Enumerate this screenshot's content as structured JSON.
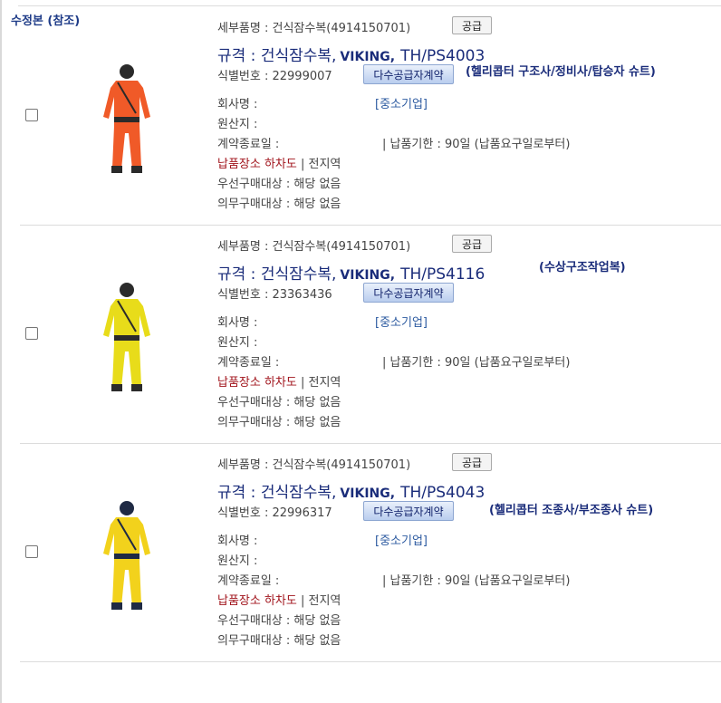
{
  "header": {
    "revision_label": "수정본 (참조)"
  },
  "items": [
    {
      "sub_name": "세부품명 : 건식잠수복(4914150701)",
      "supply_label": "공급",
      "spec_prefix": "규격 : 건식잠수복,",
      "maker": "VIKING,",
      "model": "TH/PS4003",
      "id_no": "식별번호 : 22999007",
      "mas_label": "다수공급자계약",
      "note": "(헬리콥터 구조사/정비사/탑승자 슈트)",
      "company": "회사명 :",
      "sme": "[중소기업]",
      "origin": "원산지 :",
      "contract_end": "계약종료일 :",
      "delivery": "| 납품기한 : 90일 (납품요구일로부터)",
      "place_label": "납품장소 하차도",
      "place_value": "| 전지역",
      "priority": "우선구매대상 : 해당 없음",
      "mandatory": "의무구매대상 : 해당 없음",
      "suit_color": "#f05a28",
      "suit_accent": "#2a2a2a"
    },
    {
      "sub_name": "세부품명 : 건식잠수복(4914150701)",
      "supply_label": "공급",
      "spec_prefix": "규격 : 건식잠수복,",
      "maker": "VIKING,",
      "model": "TH/PS4116",
      "id_no": "식별번호 : 23363436",
      "mas_label": "다수공급자계약",
      "note": "(수상구조작업복)",
      "company": "회사명 :",
      "sme": "[중소기업]",
      "origin": "원산지 :",
      "contract_end": "계약종료일 :",
      "delivery": "| 납품기한 : 90일 (납품요구일로부터)",
      "place_label": "납품장소 하차도",
      "place_value": "| 전지역",
      "priority": "우선구매대상 : 해당 없음",
      "mandatory": "의무구매대상 : 해당 없음",
      "suit_color": "#e8dc1a",
      "suit_accent": "#2b2b2b"
    },
    {
      "sub_name": "세부품명 : 건식잠수복(4914150701)",
      "supply_label": "공급",
      "spec_prefix": "규격 : 건식잠수복,",
      "maker": "VIKING,",
      "model": "TH/PS4043",
      "id_no": "식별번호 : 22996317",
      "mas_label": "다수공급자계약",
      "note": "(헬리콥터 조종사/부조종사 슈트)",
      "company": "회사명 :",
      "sme": "[중소기업]",
      "origin": "원산지 :",
      "contract_end": "계약종료일 :",
      "delivery": "| 납품기한 : 90일 (납품요구일로부터)",
      "place_label": "납품장소 하차도",
      "place_value": "| 전지역",
      "priority": "우선구매대상 : 해당 없음",
      "mandatory": "의무구매대상 : 해당 없음",
      "suit_color": "#f2d21c",
      "suit_accent": "#1f2a44"
    }
  ]
}
